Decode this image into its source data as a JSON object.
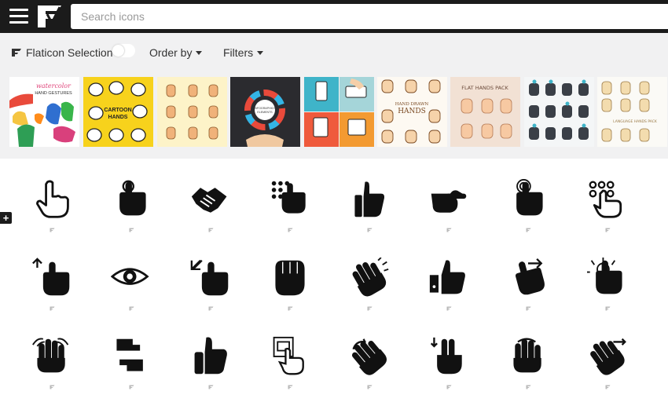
{
  "header": {
    "search_placeholder": "Search icons",
    "menu_icon": "hamburger-menu-icon",
    "logo_icon": "freepik-logo-icon"
  },
  "toolbar": {
    "flaticon_selection_label": "Flaticon Selection",
    "order_by_label": "Order by",
    "filters_label": "Filters",
    "toggle_on": false
  },
  "thumbnails": [
    {
      "name": "watercolor-hand-gestures",
      "lines": [
        "watercolor",
        "HAND GESTURES"
      ]
    },
    {
      "name": "cartoon-hands",
      "lines": [
        "CARTOON",
        "HANDS"
      ]
    },
    {
      "name": "hand-gestures-yellow",
      "lines": []
    },
    {
      "name": "infographics-elements",
      "lines": [
        "INFOGRAPHICS",
        "ELEMENTS"
      ]
    },
    {
      "name": "hands-with-phones",
      "lines": []
    },
    {
      "name": "hand-drawn-hands",
      "lines": [
        "HAND DRAWN",
        "HANDS"
      ]
    },
    {
      "name": "flat-hands-pack",
      "lines": [
        "FLAT HANDS PACK"
      ]
    },
    {
      "name": "touch-gestures",
      "lines": []
    },
    {
      "name": "language-hands-pack",
      "lines": [
        "LANGUAGE HANDS PACK"
      ]
    }
  ],
  "icons": [
    "pointing-finger-outline-icon",
    "tap-finger-icon",
    "handshake-icon",
    "dialpad-touch-icon",
    "thumbs-up-icon",
    "point-right-icon",
    "double-tap-icon",
    "keypad-touch-outline-icon",
    "swipe-up-icon",
    "eye-icon",
    "expand-gesture-icon",
    "fist-icon",
    "clapping-hands-icon",
    "like-button-icon",
    "swipe-right-icon",
    "touch-hold-icon",
    "multi-touch-icon",
    "hands-swap-icon",
    "thumbs-up-solid-icon",
    "touch-screen-icon",
    "rotate-gesture-icon",
    "two-finger-down-icon",
    "three-finger-tap-icon",
    "two-finger-swipe-icon"
  ]
}
